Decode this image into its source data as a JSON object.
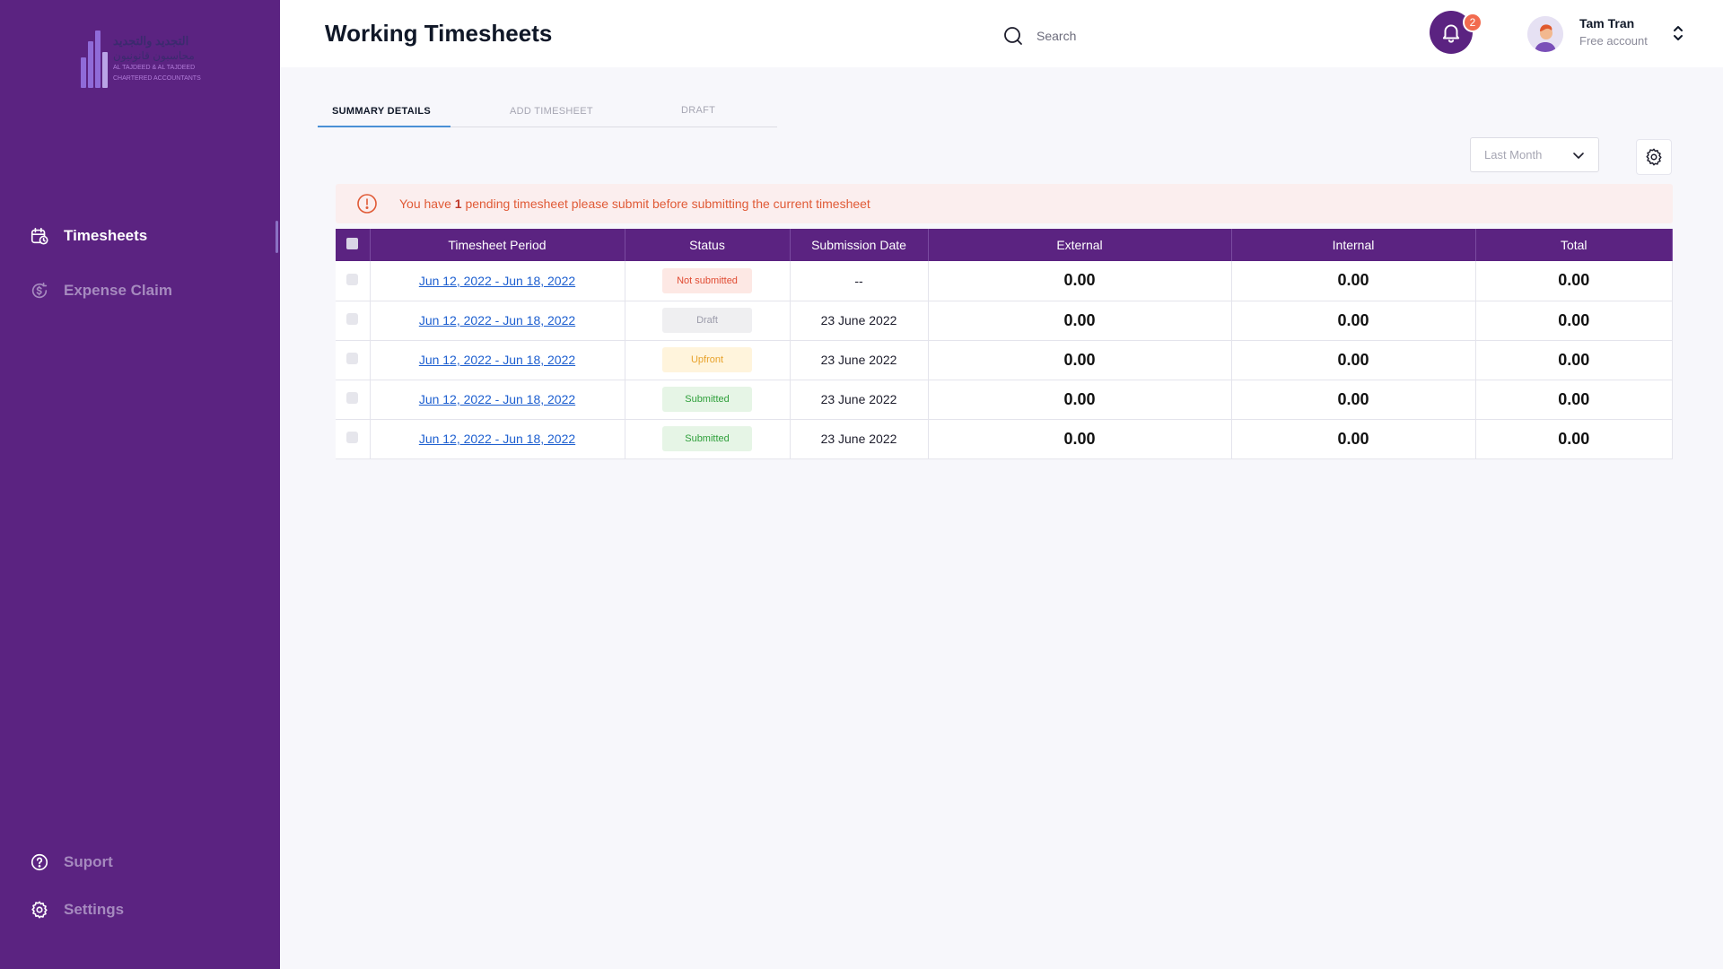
{
  "colors": {
    "sidebar_bg": "#5b2381",
    "accent": "#5b2381",
    "alert_text": "#e05a36",
    "link": "#1d5fd0",
    "badge": "#f26b4f"
  },
  "logo": {
    "line1": "التجديد والتجديد",
    "line2": "محاسبون قانونيون",
    "line3": "AL TAJDEED & AL TAJDEED",
    "line4": "CHARTERED ACCOUNTANTS"
  },
  "sidebar": {
    "items": [
      {
        "label": "Timesheets",
        "icon": "calendar-clock-icon",
        "active": true
      },
      {
        "label": "Expense Claim",
        "icon": "coin-refresh-icon",
        "active": false
      }
    ],
    "bottom": [
      {
        "label": "Suport",
        "icon": "help-circle-icon"
      },
      {
        "label": "Settings",
        "icon": "gear-icon"
      }
    ]
  },
  "header": {
    "title": "Working Timesheets",
    "search_placeholder": "Search",
    "notification_count": "2",
    "user_name": "Tam Tran",
    "user_plan": "Free account"
  },
  "tabs": [
    {
      "label": "SUMMARY DETAILS",
      "active": true
    },
    {
      "label": "ADD TIMESHEET",
      "active": false
    },
    {
      "label": "DRAFT",
      "active": false
    }
  ],
  "filter": {
    "period_value": "Last Month"
  },
  "alert": {
    "prefix": "You have ",
    "count": "1",
    "suffix": " pending timesheet please submit before submitting the current timesheet"
  },
  "table": {
    "columns": [
      "Timesheet Period",
      "Status",
      "Submission Date",
      "External",
      "Internal",
      "Total"
    ],
    "rows": [
      {
        "period": "Jun 12, 2022 - Jun 18, 2022",
        "status": "Not submitted",
        "status_type": "not",
        "date": "--",
        "external": "0.00",
        "internal": "0.00",
        "total": "0.00"
      },
      {
        "period": "Jun 12, 2022 - Jun 18, 2022",
        "status": "Draft",
        "status_type": "draft",
        "date": "23 June 2022",
        "external": "0.00",
        "internal": "0.00",
        "total": "0.00"
      },
      {
        "period": "Jun 12, 2022 - Jun 18, 2022",
        "status": "Upfront",
        "status_type": "upfront",
        "date": "23 June 2022",
        "external": "0.00",
        "internal": "0.00",
        "total": "0.00"
      },
      {
        "period": "Jun 12, 2022 - Jun 18, 2022",
        "status": "Submitted",
        "status_type": "sub",
        "date": "23 June 2022",
        "external": "0.00",
        "internal": "0.00",
        "total": "0.00"
      },
      {
        "period": "Jun 12, 2022 - Jun 18, 2022",
        "status": "Submitted",
        "status_type": "sub",
        "date": "23 June 2022",
        "external": "0.00",
        "internal": "0.00",
        "total": "0.00"
      }
    ]
  }
}
